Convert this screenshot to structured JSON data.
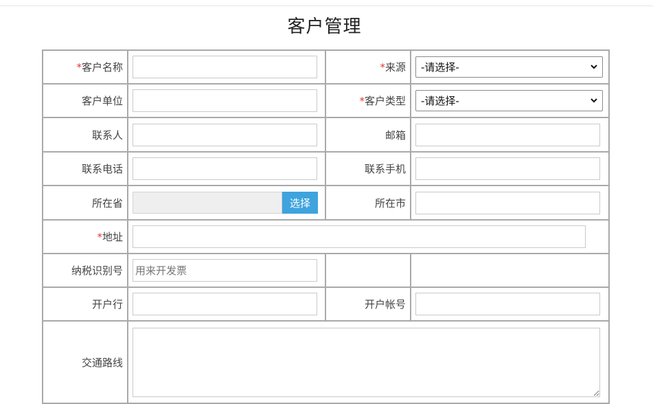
{
  "page": {
    "title": "客户管理"
  },
  "form": {
    "customer_name": {
      "label": "客户名称",
      "value": ""
    },
    "source": {
      "label": "来源",
      "selected": "-请选择-"
    },
    "customer_company": {
      "label": "客户单位",
      "value": ""
    },
    "customer_type": {
      "label": "客户类型",
      "selected": "-请选择-"
    },
    "contact_person": {
      "label": "联系人",
      "value": ""
    },
    "email": {
      "label": "邮箱",
      "value": ""
    },
    "contact_phone": {
      "label": "联系电话",
      "value": ""
    },
    "contact_mobile": {
      "label": "联系手机",
      "value": ""
    },
    "province": {
      "label": "所在省",
      "value": "",
      "button": "选择"
    },
    "city": {
      "label": "所在市",
      "value": ""
    },
    "address": {
      "label": "地址",
      "value": ""
    },
    "tax_id": {
      "label": "纳税识别号",
      "value": "",
      "placeholder": "用来开发票"
    },
    "bank": {
      "label": "开户行",
      "value": ""
    },
    "bank_account": {
      "label": "开户帐号",
      "value": ""
    },
    "transport_route": {
      "label": "交通路线",
      "value": ""
    },
    "required_mark": "*"
  },
  "colors": {
    "required": "#e53935",
    "button": "#3fa3de",
    "border": "#a9a9a9"
  }
}
